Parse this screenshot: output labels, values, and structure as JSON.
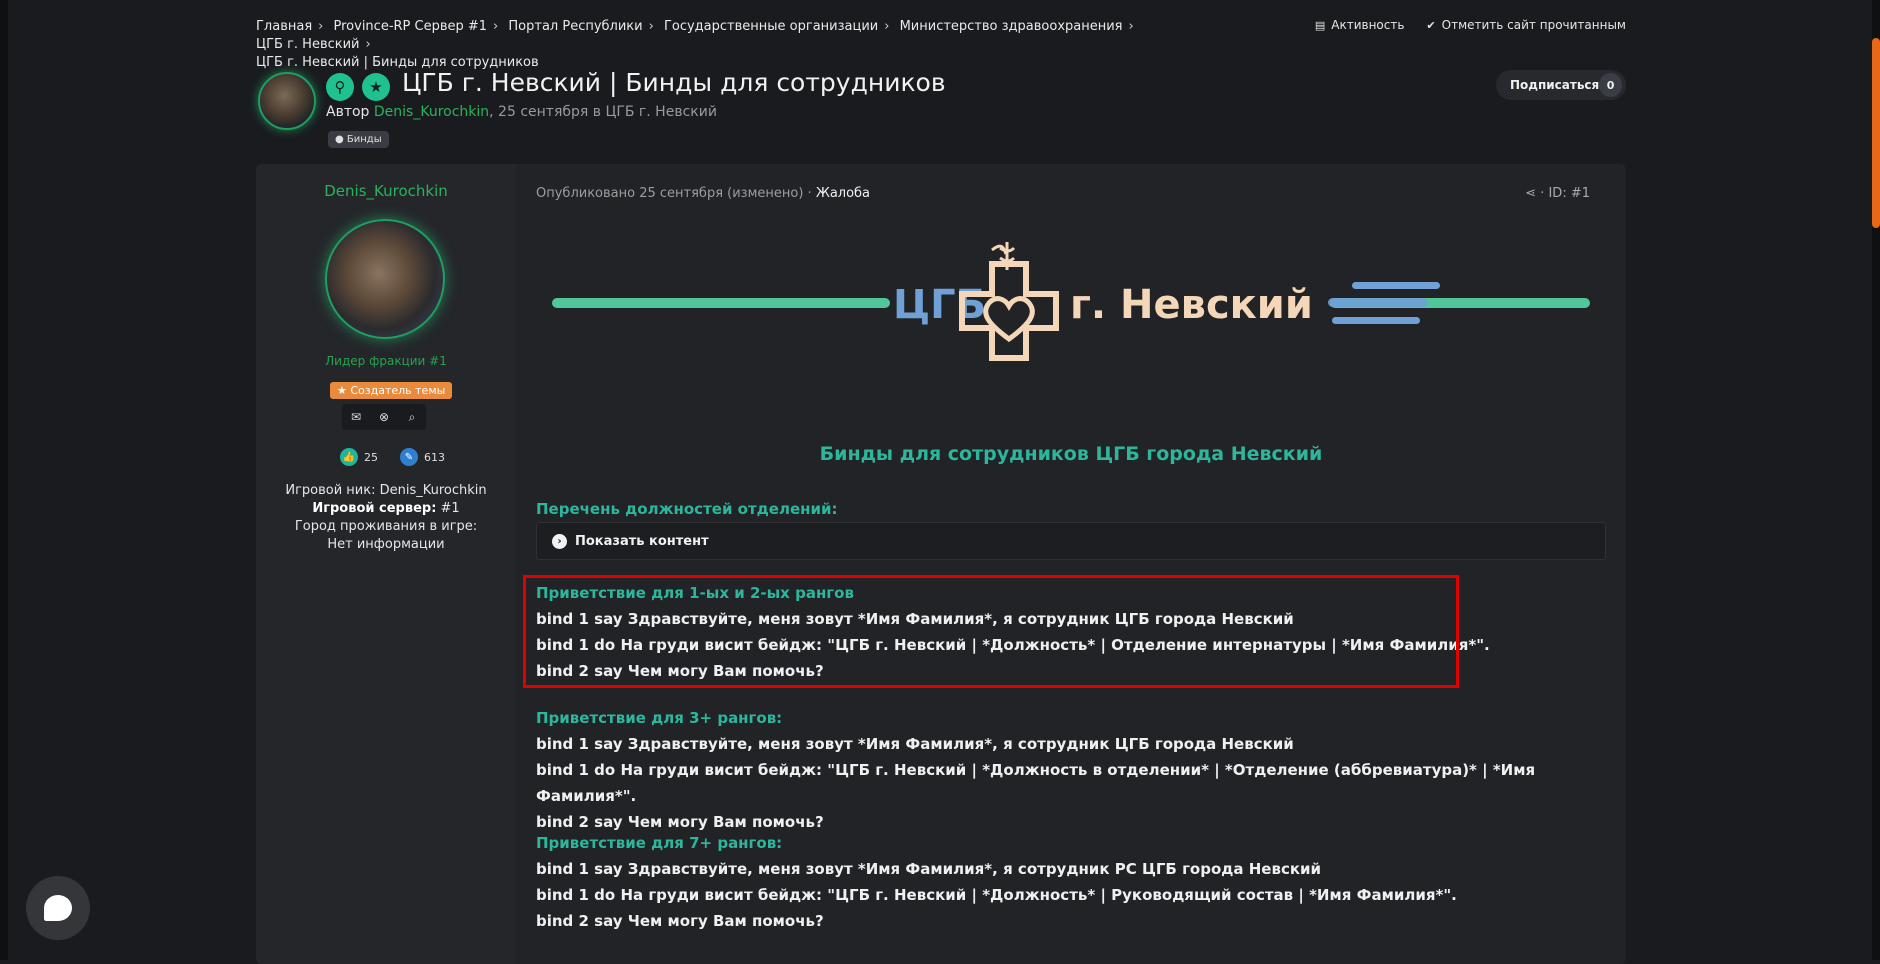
{
  "breadcrumb": {
    "items": [
      "Главная",
      "Province-RP Сервер #1",
      "Портал Республики",
      "Государственные организации",
      "Министерство здравоохранения",
      "ЦГБ г. Невский"
    ],
    "current": "ЦГБ г. Невский | Бинды для сотрудников"
  },
  "top_actions": {
    "activity": "Активность",
    "mark_read": "Отметить сайт прочитанным"
  },
  "topic": {
    "title": "ЦГБ г. Невский | Бинды для сотрудников",
    "author_label": "Автор",
    "author": "Denis_Kurochkin",
    "date_text": ", 25 сентября в ЦГБ г. Невский",
    "tag": "Бинды"
  },
  "subscribe": {
    "label": "Подписаться",
    "count": "0"
  },
  "author_panel": {
    "name": "Denis_Kurochkin",
    "rank": "Лидер фракции #1",
    "creator_badge": "Создатель темы",
    "likes": "25",
    "posts": "613",
    "info_nick": "Игровой ник: Denis_Kurochkin",
    "info_server_label": "Игровой сервер:",
    "info_server_value": " #1",
    "info_city": "Город проживания в игре: Нет информации"
  },
  "post": {
    "meta": "Опубликовано 25 сентября (изменено) · ",
    "report": "Жалоба",
    "id": "ID: #1",
    "logo_text_left": "ЦГБ",
    "logo_text_right": "г. Невский",
    "section_title": "Бинды для сотрудников ЦГБ города Невский",
    "positions_heading": "Перечень должностей отделений:",
    "spoiler_label": "Показать контент",
    "groups": [
      {
        "heading": "Приветствие для 1-ых и 2-ых рангов",
        "lines": [
          "bind 1 say Здравствуйте, меня зовут *Имя Фамилия*, я сотрудник ЦГБ города Невский",
          "bind 1 do На груди висит бейдж: \"ЦГБ г. Невский | *Должность* | Отделение интернатуры | *Имя Фамилия*\".",
          "bind 2 say Чем могу Вам помочь?"
        ]
      },
      {
        "heading": "Приветствие для 3+ рангов:",
        "lines": [
          "bind 1 say Здравствуйте, меня зовут *Имя Фамилия*, я сотрудник ЦГБ города Невский",
          "bind 1 do На груди висит бейдж: \"ЦГБ г. Невский | *Должность в отделении* | *Отделение (аббревиатура)* | *Имя Фамилия*\".",
          "bind 2 say Чем могу Вам помочь?"
        ]
      },
      {
        "heading": "Приветствие для 7+ рангов:",
        "lines": [
          "bind 1 say Здравствуйте, меня зовут *Имя Фамилия*, я сотрудник РС ЦГБ города Невский",
          "bind 1 do На груди висит бейдж: \"ЦГБ г. Невский | *Должность* | Руководящий состав | *Имя Фамилия*\".",
          "bind 2 say Чем могу Вам помочь?"
        ]
      }
    ]
  },
  "colors": {
    "accent_green": "#2cb79c",
    "author_green": "#29b35a",
    "highlight_red": "#e00000",
    "scroll_orange": "#e8681a"
  }
}
